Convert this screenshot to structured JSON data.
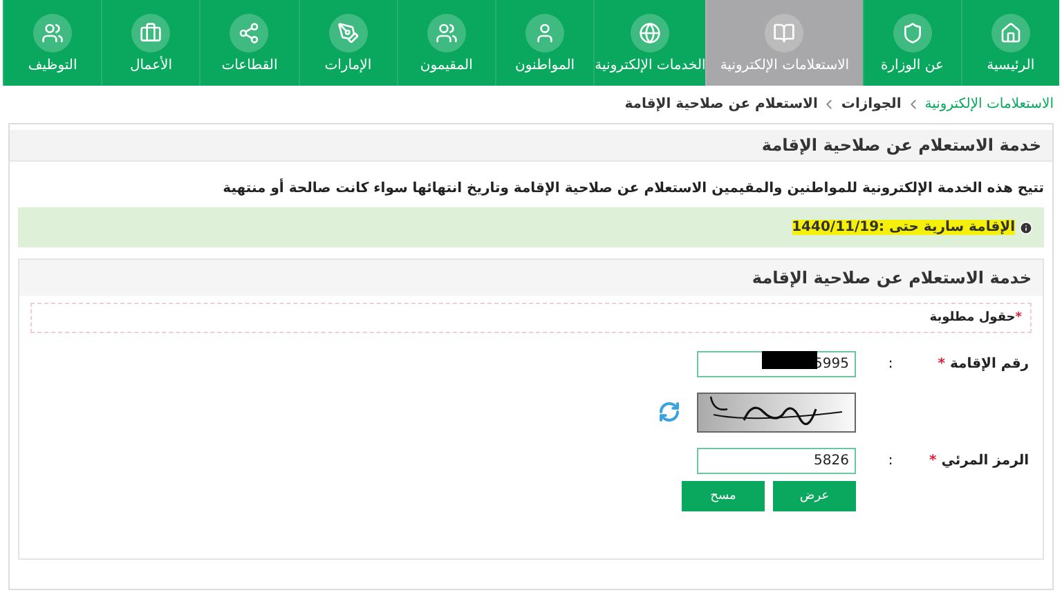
{
  "nav": {
    "items": [
      {
        "label": "الرئيسية",
        "selected": false
      },
      {
        "label": "عن الوزارة",
        "selected": false
      },
      {
        "label": "الاستعلامات الإلكترونية",
        "selected": true
      },
      {
        "label": "الخدمات الإلكترونية",
        "selected": false
      },
      {
        "label": "المواطنون",
        "selected": false
      },
      {
        "label": "المقيمون",
        "selected": false
      },
      {
        "label": "الإمارات",
        "selected": false
      },
      {
        "label": "القطاعات",
        "selected": false
      },
      {
        "label": "الأعمال",
        "selected": false
      },
      {
        "label": "التوظيف",
        "selected": false
      }
    ]
  },
  "breadcrumb": [
    {
      "label": "الاستعلامات الإلكترونية",
      "link": true
    },
    {
      "label": "الجوازات",
      "link": false
    },
    {
      "label": "الاستعلام عن صلاحية الإقامة",
      "link": false
    }
  ],
  "page_title": "خدمة الاستعلام عن صلاحية الإقامة",
  "description": "تتيح هذه الخدمة الإلكترونية للمواطنين والمقيمين الاستعلام عن صلاحية الإقامة وتاريخ انتهائها سواء كانت صالحة أو منتهية",
  "alert": {
    "text": "الإقامة سارية حتى :1440/11/19",
    "highlighted": true
  },
  "form": {
    "title": "خدمة الاستعلام عن صلاحية الإقامة",
    "required_note": {
      "mark": "*",
      "text": "حقول مطلوبة"
    },
    "fields": [
      {
        "kind": "input",
        "label": "رقم الإقامة",
        "mark": "*",
        "colon": ":",
        "value": "5995",
        "redacted": true
      },
      {
        "kind": "captcha"
      },
      {
        "kind": "input",
        "label": "الرمز المرئي",
        "mark": "*",
        "colon": ":",
        "value": "5826",
        "redacted": false
      }
    ],
    "buttons": [
      "عرض",
      "مسح"
    ]
  }
}
